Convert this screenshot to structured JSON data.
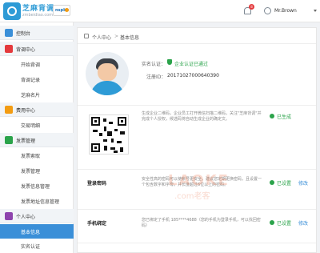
{
  "header": {
    "brand_title": "芝麻背调",
    "brand_url": "zmbeidiao.com",
    "partner_label": "nspbx",
    "notification_count": "8",
    "user_name": "Mr.Brown"
  },
  "sidebar": {
    "groups": [
      {
        "label": "控制台",
        "icon": "dashboard-icon",
        "color": "#3a8fd8"
      },
      {
        "label": "背调中心",
        "icon": "survey-icon",
        "color": "#e4393c"
      },
      {
        "label": "费用中心",
        "icon": "billing-icon",
        "color": "#f39c12"
      },
      {
        "label": "发票管理",
        "icon": "invoice-icon",
        "color": "#2aa34a"
      },
      {
        "label": "个人中心",
        "icon": "person-icon",
        "color": "#8e44ad"
      }
    ],
    "items": [
      {
        "label": "开始背调"
      },
      {
        "label": "背调记录"
      },
      {
        "label": "芝麻名片"
      },
      {
        "label": "交易明细"
      },
      {
        "label": "发票索取"
      },
      {
        "label": "发票管理"
      },
      {
        "label": "发票信息管理"
      },
      {
        "label": "发票地址信息管理"
      },
      {
        "label": "基本信息"
      },
      {
        "label": "实名认证"
      }
    ],
    "active_item": "基本信息"
  },
  "breadcrumb": {
    "level1": "个人中心",
    "separator": ">",
    "level2": "基本信息"
  },
  "profile": {
    "auth_label": "实名认证：",
    "auth_status": "企业认证已通过",
    "reg_label": "注册ID：",
    "reg_id": "20171027000640390"
  },
  "qr_section": {
    "description": "生成企业二维码，企业员工打开微信扫描二维码，关注\"芝麻背调\"并完成个人授权，候选码将自动生成企业的确定文。",
    "status": "已生成"
  },
  "login_section": {
    "title": "登录密码",
    "description": "安全性高的密码可以使帐号更安全，建议您定期更换密码，且设置一个包含数字和字母，并长度超过6位以上的密码。",
    "status": "已设置",
    "action": "修改"
  },
  "phone_section": {
    "title": "手机绑定",
    "description": "您已绑定了手机 185****4688（您的手机为登录手机，可以找回密码）",
    "status": "已设置",
    "action": "修改"
  },
  "watermark": {
    "text": "LAOKE",
    "sub": ".com老客"
  },
  "colors": {
    "accent": "#3a8fd8",
    "success": "#2aa34a",
    "danger": "#e4393c"
  }
}
